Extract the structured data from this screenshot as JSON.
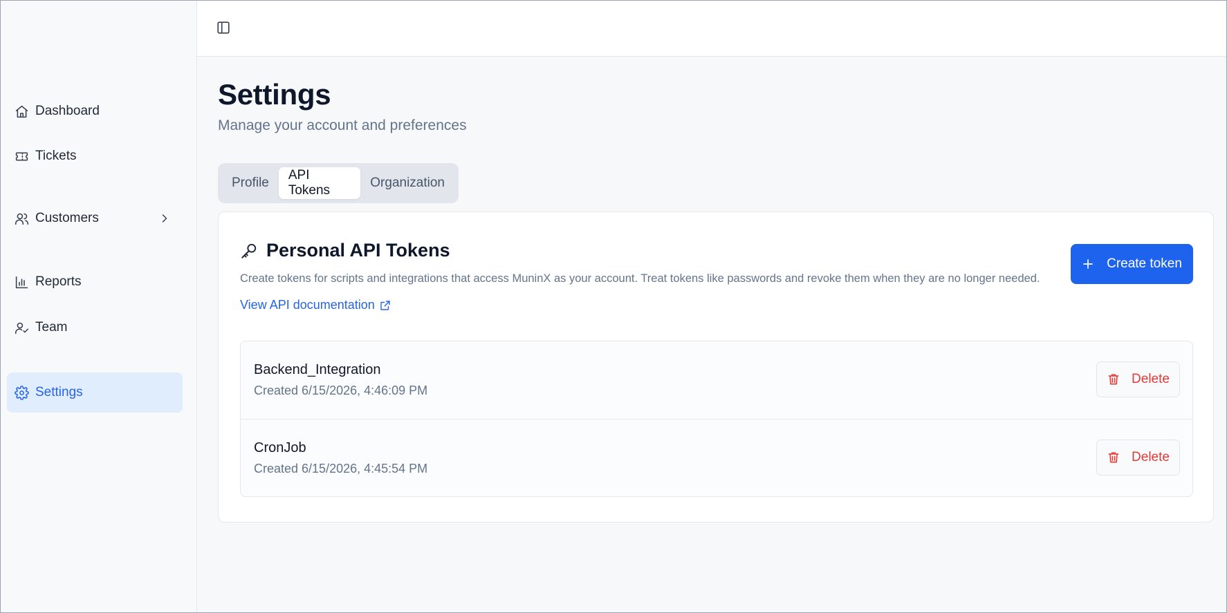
{
  "sidebar": {
    "items": [
      {
        "label": "Dashboard",
        "icon": "home-icon"
      },
      {
        "label": "Tickets",
        "icon": "ticket-icon"
      },
      {
        "label": "Customers",
        "icon": "users-icon",
        "has_submenu": true
      },
      {
        "label": "Reports",
        "icon": "bar-chart-icon"
      },
      {
        "label": "Team",
        "icon": "user-check-icon"
      },
      {
        "label": "Settings",
        "icon": "gear-icon",
        "active": true
      }
    ]
  },
  "topbar": {
    "toggle_icon": "sidebar-toggle-icon"
  },
  "page": {
    "title": "Settings",
    "subtitle": "Manage your account and preferences"
  },
  "tabs": [
    {
      "label": "Profile",
      "active": false
    },
    {
      "label": "API Tokens",
      "active": true
    },
    {
      "label": "Organization",
      "active": false
    }
  ],
  "card": {
    "title": "Personal API Tokens",
    "title_icon": "key-icon",
    "description": "Create tokens for scripts and integrations that access MuninX as your account. Treat tokens like passwords and revoke them when they are no longer needed.",
    "doc_link": "View API documentation",
    "create_button": "Create token"
  },
  "tokens": [
    {
      "name": "Backend_Integration",
      "created": "Created 6/15/2026, 4:46:09 PM",
      "delete_label": "Delete"
    },
    {
      "name": "CronJob",
      "created": "Created 6/15/2026, 4:45:54 PM",
      "delete_label": "Delete"
    }
  ],
  "colors": {
    "accent": "#1d63ed",
    "active_nav_bg": "#e0edfc",
    "danger": "#e53935",
    "muted_text": "#64748b"
  }
}
